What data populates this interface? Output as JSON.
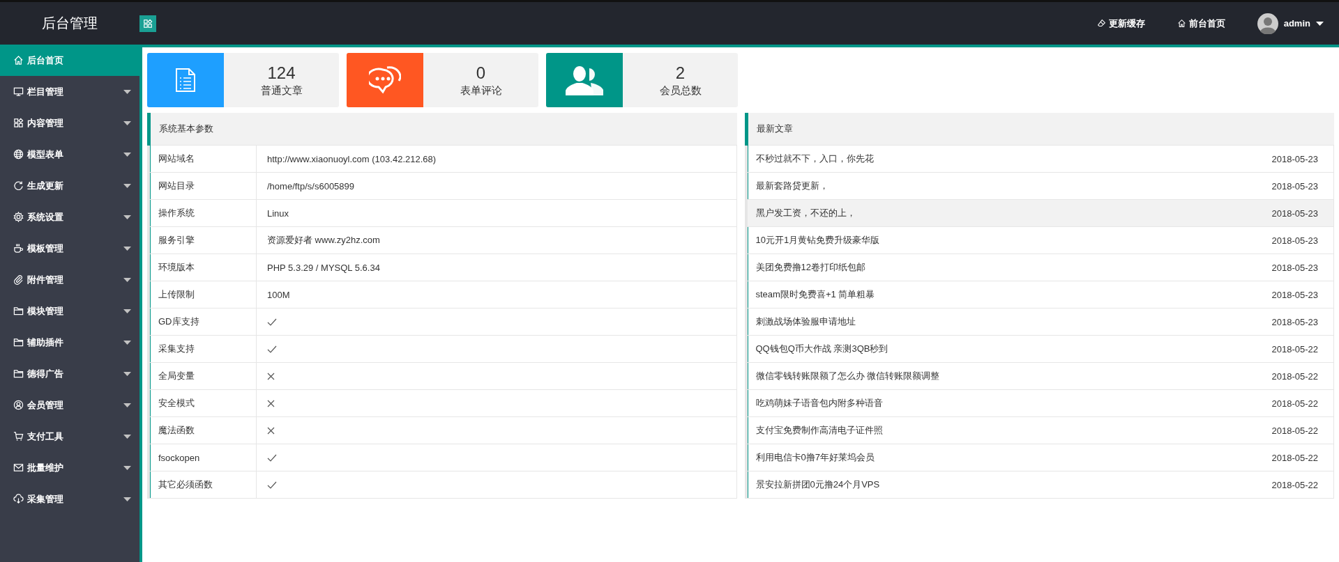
{
  "header": {
    "title": "后台管理",
    "links": [
      {
        "label": "更新缓存"
      },
      {
        "label": "前台首页"
      }
    ],
    "user": "admin"
  },
  "sidebar": {
    "items": [
      {
        "label": "后台首页",
        "selected": true,
        "expandable": false
      },
      {
        "label": "栏目管理",
        "selected": false,
        "expandable": true
      },
      {
        "label": "内容管理",
        "selected": false,
        "expandable": true
      },
      {
        "label": "模型表单",
        "selected": false,
        "expandable": true
      },
      {
        "label": "生成更新",
        "selected": false,
        "expandable": true
      },
      {
        "label": "系统设置",
        "selected": false,
        "expandable": true
      },
      {
        "label": "模板管理",
        "selected": false,
        "expandable": true
      },
      {
        "label": "附件管理",
        "selected": false,
        "expandable": true
      },
      {
        "label": "模块管理",
        "selected": false,
        "expandable": true
      },
      {
        "label": "辅助插件",
        "selected": false,
        "expandable": true
      },
      {
        "label": "德得广告",
        "selected": false,
        "expandable": true
      },
      {
        "label": "会员管理",
        "selected": false,
        "expandable": true
      },
      {
        "label": "支付工具",
        "selected": false,
        "expandable": true
      },
      {
        "label": "批量维护",
        "selected": false,
        "expandable": true
      },
      {
        "label": "采集管理",
        "selected": false,
        "expandable": true
      }
    ]
  },
  "stats": [
    {
      "color": "#1e9fff",
      "count": "124",
      "label": "普通文章"
    },
    {
      "color": "#ff5722",
      "count": "0",
      "label": "表单评论"
    },
    {
      "color": "#009688",
      "count": "2",
      "label": "会员总数"
    }
  ],
  "system_panel": {
    "title": "系统基本参数",
    "rows": [
      {
        "label": "网站域名",
        "kind": "text",
        "value": "http://www.xiaonuoyl.com (103.42.212.68)"
      },
      {
        "label": "网站目录",
        "kind": "text",
        "value": "/home/ftp/s/s6005899"
      },
      {
        "label": "操作系统",
        "kind": "text",
        "value": "Linux"
      },
      {
        "label": "服务引擎",
        "kind": "text",
        "value": "资源爱好者 www.zy2hz.com"
      },
      {
        "label": "环境版本",
        "kind": "text",
        "value": "PHP 5.3.29 / MYSQL 5.6.34"
      },
      {
        "label": "上传限制",
        "kind": "text",
        "value": "100M"
      },
      {
        "label": "GD库支持",
        "kind": "status",
        "supported": true
      },
      {
        "label": "采集支持",
        "kind": "status",
        "supported": true
      },
      {
        "label": "全局变量",
        "kind": "status",
        "supported": false
      },
      {
        "label": "安全模式",
        "kind": "status",
        "supported": false
      },
      {
        "label": "魔法函数",
        "kind": "status",
        "supported": false
      },
      {
        "label": "fsockopen",
        "kind": "status",
        "supported": true
      },
      {
        "label": "其它必须函数",
        "kind": "status",
        "supported": true
      }
    ]
  },
  "articles_panel": {
    "title": "最新文章",
    "rows": [
      {
        "title": "不秒过就不下，入口，你先花",
        "date": "2018-05-23",
        "highlighted": false
      },
      {
        "title": "最新套路贷更新，",
        "date": "2018-05-23",
        "highlighted": false
      },
      {
        "title": "黑户发工资，不还的上，",
        "date": "2018-05-23",
        "highlighted": true
      },
      {
        "title": "10元开1月黄钻免费升级豪华版",
        "date": "2018-05-23",
        "highlighted": false
      },
      {
        "title": "美团免费撸12卷打印纸包邮",
        "date": "2018-05-23",
        "highlighted": false
      },
      {
        "title": "steam限时免费喜+1 简单粗暴",
        "date": "2018-05-23",
        "highlighted": false
      },
      {
        "title": "刺激战场体验服申请地址",
        "date": "2018-05-23",
        "highlighted": false
      },
      {
        "title": "QQ钱包Q币大作战 亲测3QB秒到",
        "date": "2018-05-22",
        "highlighted": false
      },
      {
        "title": "微信零钱转账限额了怎么办 微信转账限额调整",
        "date": "2018-05-22",
        "highlighted": false
      },
      {
        "title": "吃鸡萌妹子语音包内附多种语音",
        "date": "2018-05-22",
        "highlighted": false
      },
      {
        "title": "支付宝免费制作高清电子证件照",
        "date": "2018-05-22",
        "highlighted": false
      },
      {
        "title": "利用电信卡0撸7年好莱坞会员",
        "date": "2018-05-22",
        "highlighted": false
      },
      {
        "title": "景安拉新拼团0元撸24个月VPS",
        "date": "2018-05-22",
        "highlighted": false
      }
    ]
  }
}
